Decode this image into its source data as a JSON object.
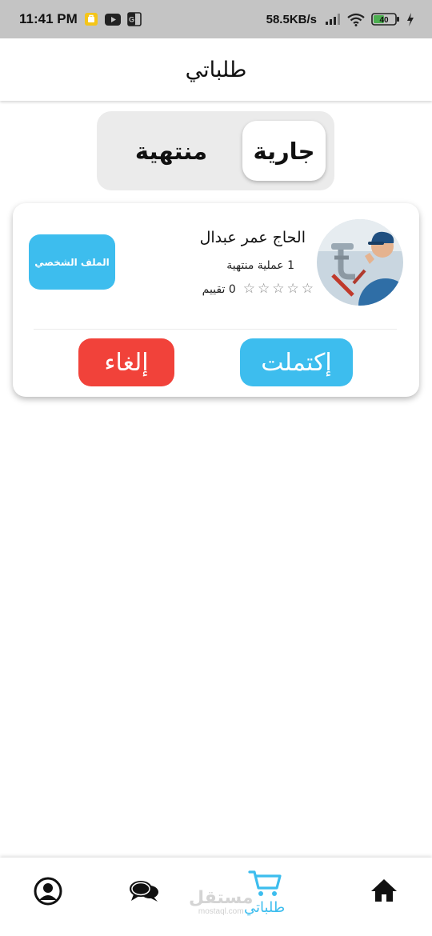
{
  "status_bar": {
    "time": "11:41 PM",
    "net_speed": "58.5KB/s",
    "battery": "40"
  },
  "header": {
    "title": "طلباتي"
  },
  "tabs": {
    "active_label": "جارية",
    "inactive_label": "منتهية"
  },
  "order_card": {
    "name": "الحاج عمر عبدال",
    "completed_ops": "1 عملية منتهية",
    "rating_text": "0 تقييم",
    "rating_value": 0,
    "rating_max": 5,
    "profile_button": "الملف الشخصي",
    "complete_button": "إكتملت",
    "cancel_button": "إلغاء"
  },
  "bottom_nav": {
    "items": [
      {
        "icon": "person-circle-icon"
      },
      {
        "icon": "chat-bubbles-icon"
      },
      {
        "icon": "cart-icon",
        "label": "طلباتي",
        "active": true
      },
      {
        "icon": "home-icon"
      }
    ],
    "watermark": {
      "main": "مستقل",
      "sub": "mostaql.com"
    }
  },
  "colors": {
    "accent": "#3dbdee",
    "danger": "#f1423a",
    "status_bar": "#c4c4c4",
    "tab_bg": "#ebebeb"
  }
}
